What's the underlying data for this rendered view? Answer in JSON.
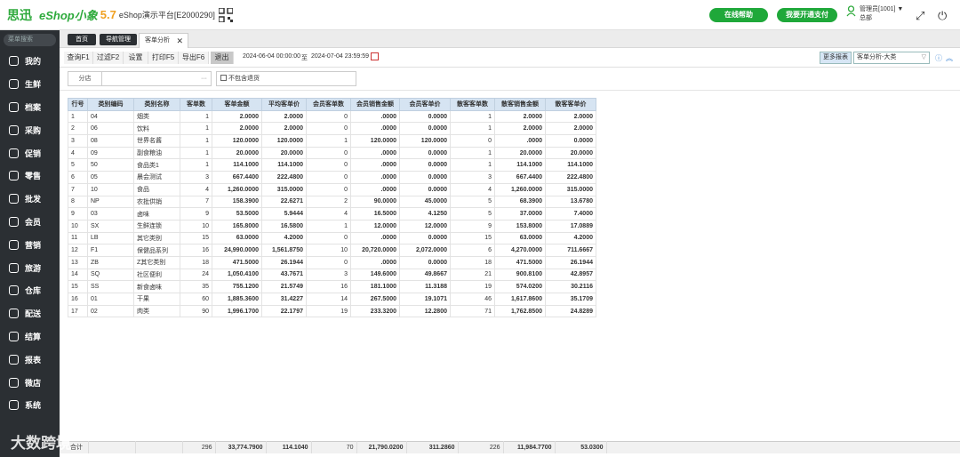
{
  "app": {
    "logo_cn": "思迅",
    "logo_en": "eShop小象",
    "version": "5.7",
    "platform": "eShop演示平台[E2000290]"
  },
  "header": {
    "help_btn": "在线帮助",
    "pay_btn": "我要开通支付",
    "user": "管理员[1001] ▼",
    "org": "总部"
  },
  "sidebar": {
    "search_placeholder": "菜单搜索",
    "items": [
      "我的",
      "生鲜",
      "档案",
      "采购",
      "促销",
      "零售",
      "批发",
      "会员",
      "营销",
      "旅游",
      "仓库",
      "配送",
      "结算",
      "报表",
      "微店",
      "系统"
    ]
  },
  "tabs": {
    "home": "首页",
    "nav": "导航管理",
    "active": "客单分析"
  },
  "toolbar": {
    "query": "查询F1",
    "filter": "过滤F2",
    "settings": "设置",
    "print": "打印F5",
    "export": "导出F6",
    "exit": "退出",
    "date_from": "2024-06-04 00:00:00",
    "date_sep": "至",
    "date_to": "2024-07-04 23:59:59",
    "more": "更多报表",
    "report_select": "客单分析-大类"
  },
  "filter": {
    "branch_label": "分店",
    "branch_value": "",
    "exclude_return": "不包含退货"
  },
  "table": {
    "headers": [
      "行号",
      "类别编码",
      "类别名称",
      "客单数",
      "客单金额",
      "平均客单价",
      "会员客单数",
      "会员销售金额",
      "会员客单价",
      "散客客单数",
      "散客销售金额",
      "散客客单价"
    ],
    "rows": [
      [
        "1",
        "04",
        "烟类",
        "1",
        "2.0000",
        "2.0000",
        "0",
        ".0000",
        "0.0000",
        "1",
        "2.0000",
        "2.0000"
      ],
      [
        "2",
        "06",
        "饮料",
        "1",
        "2.0000",
        "2.0000",
        "0",
        ".0000",
        "0.0000",
        "1",
        "2.0000",
        "2.0000"
      ],
      [
        "3",
        "08",
        "世界名酱",
        "1",
        "120.0000",
        "120.0000",
        "1",
        "120.0000",
        "120.0000",
        "0",
        ".0000",
        "0.0000"
      ],
      [
        "4",
        "09",
        "副食粮油",
        "1",
        "20.0000",
        "20.0000",
        "0",
        ".0000",
        "0.0000",
        "1",
        "20.0000",
        "20.0000"
      ],
      [
        "5",
        "50",
        "食品类1",
        "1",
        "114.1000",
        "114.1000",
        "0",
        ".0000",
        "0.0000",
        "1",
        "114.1000",
        "114.1000"
      ],
      [
        "6",
        "05",
        "晨会测试",
        "3",
        "667.4400",
        "222.4800",
        "0",
        ".0000",
        "0.0000",
        "3",
        "667.4400",
        "222.4800"
      ],
      [
        "7",
        "10",
        "食品",
        "4",
        "1,260.0000",
        "315.0000",
        "0",
        ".0000",
        "0.0000",
        "4",
        "1,260.0000",
        "315.0000"
      ],
      [
        "8",
        "NP",
        "农批供销",
        "7",
        "158.3900",
        "22.6271",
        "2",
        "90.0000",
        "45.0000",
        "5",
        "68.3900",
        "13.6780"
      ],
      [
        "9",
        "03",
        "卤味",
        "9",
        "53.5000",
        "5.9444",
        "4",
        "16.5000",
        "4.1250",
        "5",
        "37.0000",
        "7.4000"
      ],
      [
        "10",
        "SX",
        "生鲜连锁",
        "10",
        "165.8000",
        "16.5800",
        "1",
        "12.0000",
        "12.0000",
        "9",
        "153.8000",
        "17.0889"
      ],
      [
        "11",
        "LB",
        "其它类别",
        "15",
        "63.0000",
        "4.2000",
        "0",
        ".0000",
        "0.0000",
        "15",
        "63.0000",
        "4.2000"
      ],
      [
        "12",
        "F1",
        "保健品系列",
        "16",
        "24,990.0000",
        "1,561.8750",
        "10",
        "20,720.0000",
        "2,072.0000",
        "6",
        "4,270.0000",
        "711.6667"
      ],
      [
        "13",
        "ZB",
        "Z其它类别",
        "18",
        "471.5000",
        "26.1944",
        "0",
        ".0000",
        "0.0000",
        "18",
        "471.5000",
        "26.1944"
      ],
      [
        "14",
        "SQ",
        "社区便利",
        "24",
        "1,050.4100",
        "43.7671",
        "3",
        "149.6000",
        "49.8667",
        "21",
        "900.8100",
        "42.8957"
      ],
      [
        "15",
        "SS",
        "新食卤味",
        "35",
        "755.1200",
        "21.5749",
        "16",
        "181.1000",
        "11.3188",
        "19",
        "574.0200",
        "30.2116"
      ],
      [
        "16",
        "01",
        "干果",
        "60",
        "1,885.3600",
        "31.4227",
        "14",
        "267.5000",
        "19.1071",
        "46",
        "1,617.8600",
        "35.1709"
      ],
      [
        "17",
        "02",
        "肉类",
        "90",
        "1,996.1700",
        "22.1797",
        "19",
        "233.3200",
        "12.2800",
        "71",
        "1,762.8500",
        "24.8289"
      ]
    ],
    "totals": [
      "合计",
      "",
      "",
      "296",
      "33,774.7900",
      "114.1040",
      "70",
      "21,790.0200",
      "311.2860",
      "226",
      "11,984.7700",
      "53.0300"
    ]
  },
  "watermark": "大数跨境"
}
